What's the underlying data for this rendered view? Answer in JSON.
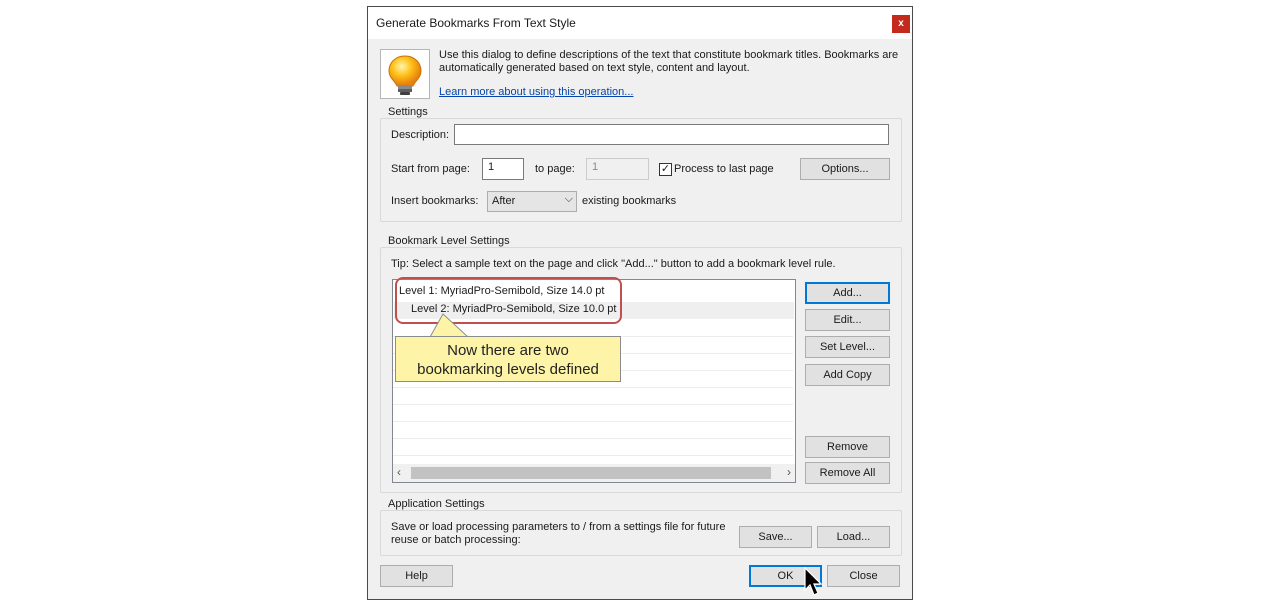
{
  "dialog": {
    "title": "Generate Bookmarks From Text Style",
    "close_glyph": "x",
    "info_text": "Use this dialog to define descriptions of the text that constitute bookmark titles. Bookmarks are automatically generated based on text style, content and layout.",
    "info_link": "Learn more about using this operation..."
  },
  "settings": {
    "legend": "Settings",
    "description_label": "Description:",
    "description_value": "",
    "start_page_label": "Start from page:",
    "start_page_value": "1",
    "to_page_label": "to page:",
    "to_page_value": "1",
    "process_last_label": "Process to last page",
    "process_last_checked": "✓",
    "options_button": "Options...",
    "insert_label": "Insert bookmarks:",
    "insert_value": "After",
    "existing_label": "existing bookmarks"
  },
  "levels": {
    "legend": "Bookmark Level Settings",
    "tip": "Tip: Select a sample text on the page and click \"Add...\" button to add a bookmark level rule.",
    "items": [
      "Level 1: MyriadPro-Semibold, Size 14.0 pt",
      "Level 2: MyriadPro-Semibold, Size 10.0 pt"
    ],
    "buttons": {
      "add": "Add...",
      "edit": "Edit...",
      "set_level": "Set Level...",
      "add_copy": "Add Copy",
      "remove": "Remove",
      "remove_all": "Remove All"
    },
    "callout_line1": "Now there are two",
    "callout_line2": "bookmarking levels defined"
  },
  "app_settings": {
    "legend": "Application Settings",
    "text": "Save or load processing parameters to / from a settings file for future reuse or batch processing:",
    "save_button": "Save...",
    "load_button": "Load..."
  },
  "footer": {
    "help_button": "Help",
    "ok_button": "OK",
    "close_button": "Close"
  },
  "colors": {
    "accent": "#0078d7",
    "close_red": "#c42b1c",
    "callout_fill": "#fdf4a7",
    "highlight_ring": "#c0504d",
    "link": "#0645ad"
  },
  "icons": {
    "bulb": "lightbulb-icon",
    "cursor": "mouse-pointer-icon",
    "combo_arrow": "chevron-down-icon",
    "scroll_left": "chevron-left-icon",
    "scroll_right": "chevron-right-icon"
  }
}
